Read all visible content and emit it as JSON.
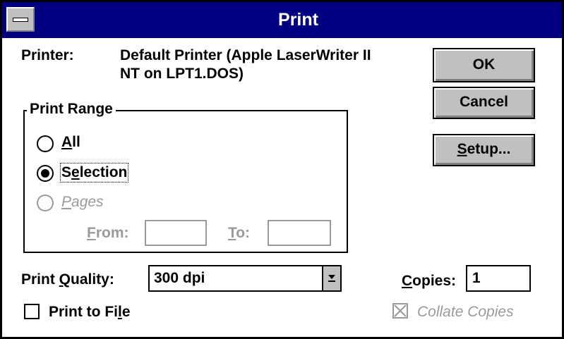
{
  "window": {
    "title": "Print"
  },
  "printer": {
    "label": "Printer:",
    "value_line1": "Default Printer (Apple LaserWriter II",
    "value_line2": "NT on LPT1.DOS)"
  },
  "buttons": {
    "ok": "OK",
    "cancel": "Cancel",
    "setup": "Setup..."
  },
  "print_range": {
    "title": "Print Range",
    "all": "All",
    "selection": "Selection",
    "pages": "Pages",
    "selected": "selection",
    "from_label": "From:",
    "from_value": "",
    "to_label": "To:",
    "to_value": ""
  },
  "print_quality": {
    "label": "Print Quality:",
    "value": "300 dpi"
  },
  "copies": {
    "label": "Copies:",
    "value": "1"
  },
  "print_to_file": {
    "label": "Print to File",
    "checked": false
  },
  "collate": {
    "label": "Collate Copies",
    "checked": true,
    "enabled": false
  }
}
